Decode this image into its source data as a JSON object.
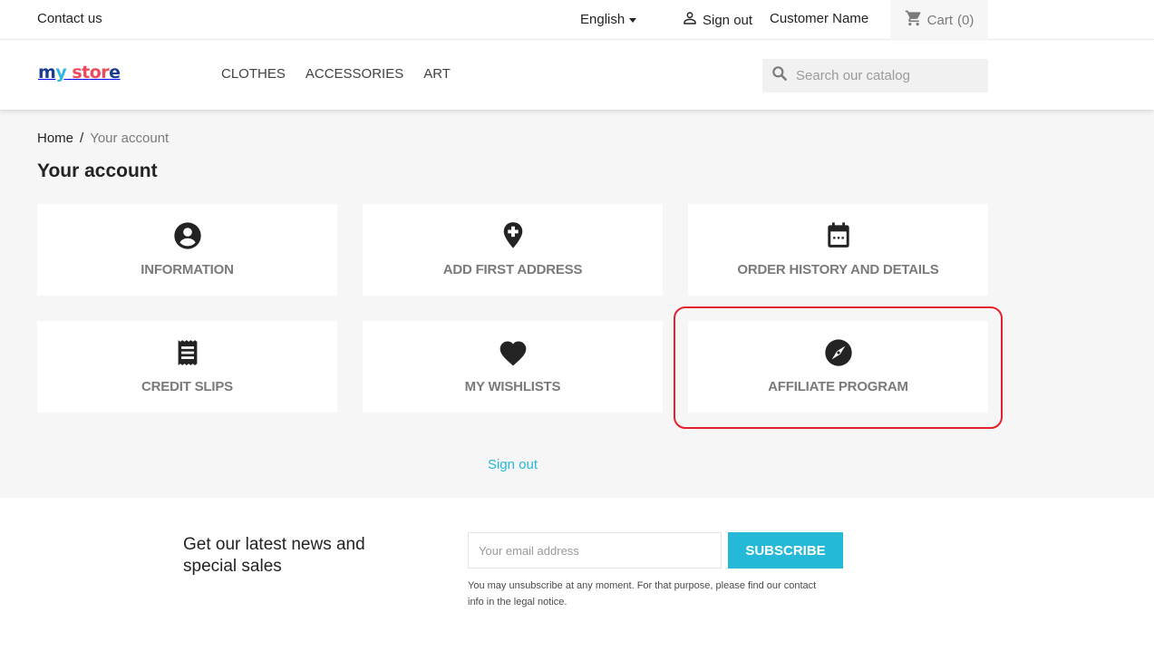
{
  "topbar": {
    "contact_label": "Contact us",
    "language": "English",
    "signout_label": "Sign out",
    "customer_name": "Customer Name",
    "cart_label": "Cart",
    "cart_count": "(0)"
  },
  "header": {
    "logo": {
      "m": "m",
      "y": "y",
      "space": " ",
      "s": "s",
      "t": "t",
      "o": "o",
      "r": "r",
      "e": "e"
    },
    "logo_text": "my store",
    "menu": [
      {
        "label": "CLOTHES"
      },
      {
        "label": "ACCESSORIES"
      },
      {
        "label": "ART"
      }
    ],
    "search_placeholder": "Search our catalog"
  },
  "breadcrumb": {
    "items": [
      {
        "label": "Home"
      },
      {
        "label": "Your account"
      }
    ],
    "separator": "/"
  },
  "page": {
    "title": "Your account"
  },
  "account_links": [
    {
      "label": "INFORMATION",
      "icon": "account-circle-icon"
    },
    {
      "label": "ADD FIRST ADDRESS",
      "icon": "add-location-icon"
    },
    {
      "label": "ORDER HISTORY AND DETAILS",
      "icon": "calendar-icon"
    },
    {
      "label": "CREDIT SLIPS",
      "icon": "receipt-icon"
    },
    {
      "label": "MY WISHLISTS",
      "icon": "heart-icon"
    },
    {
      "label": "AFFILIATE PROGRAM",
      "icon": "compass-icon",
      "highlighted": true
    }
  ],
  "signout_link": "Sign out",
  "newsletter": {
    "title": "Get our latest news and special sales",
    "email_placeholder": "Your email address",
    "email_value": "",
    "subscribe_label": "SUBSCRIBE",
    "notice": "You may unsubscribe at any moment. For that purpose, please find our contact info in the legal notice."
  },
  "colors": {
    "accent": "#24b9d7",
    "highlight": "#e3222c",
    "background": "#f6f6f6"
  }
}
